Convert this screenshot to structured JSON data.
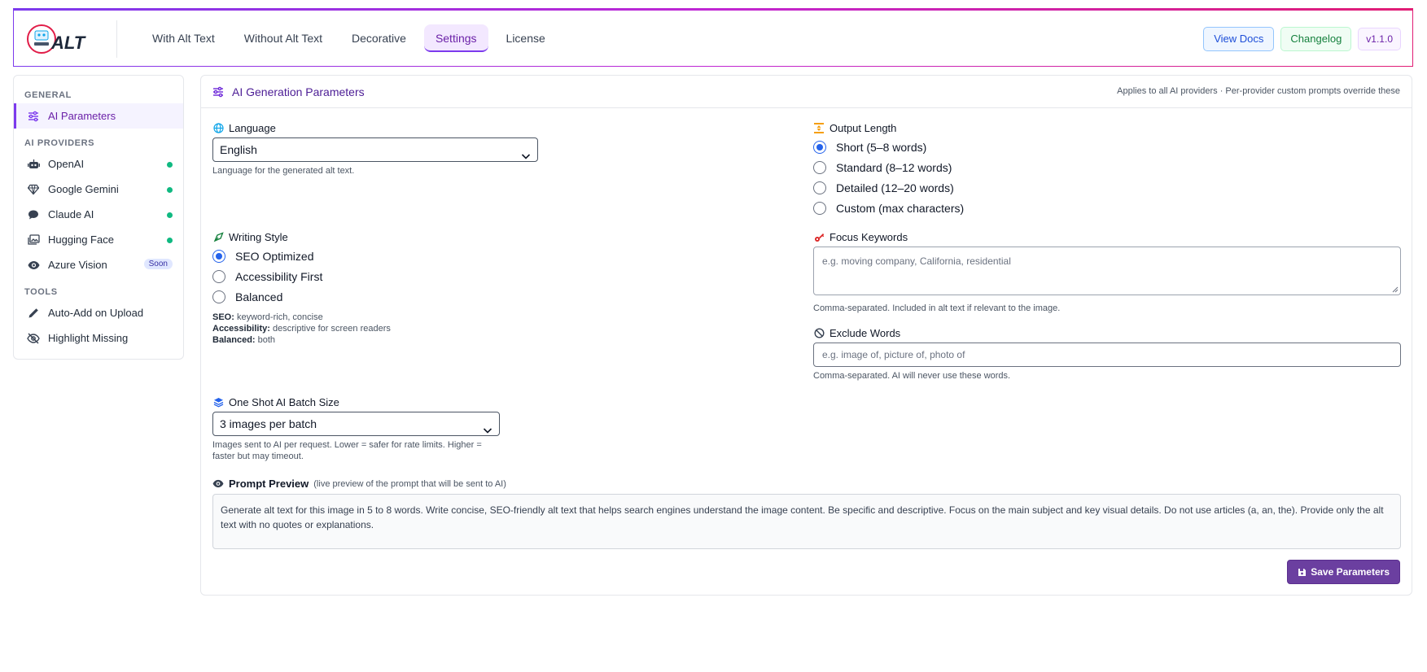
{
  "header": {
    "logo_text": "ALT",
    "tabs": [
      {
        "label": "With Alt Text"
      },
      {
        "label": "Without Alt Text"
      },
      {
        "label": "Decorative"
      },
      {
        "label": "Settings"
      },
      {
        "label": "License"
      }
    ],
    "active_tab": "Settings",
    "view_docs_label": "View Docs",
    "changelog_label": "Changelog",
    "version": "v1.1.0",
    "accent_colors": [
      "#7c3aed",
      "#c026d3",
      "#e11d74"
    ]
  },
  "sidebar": {
    "general_label": "GENERAL",
    "providers_label": "AI PROVIDERS",
    "tools_label": "TOOLS",
    "items": {
      "ai_parameters": {
        "label": "AI Parameters",
        "icon": "sliders-icon"
      },
      "openai": {
        "label": "OpenAI",
        "icon": "robot-icon",
        "status": "active"
      },
      "gemini": {
        "label": "Google Gemini",
        "icon": "gem-icon",
        "status": "active"
      },
      "claude": {
        "label": "Claude AI",
        "icon": "chat-icon",
        "status": "active"
      },
      "hugging": {
        "label": "Hugging Face",
        "icon": "images-icon",
        "status": "active"
      },
      "azure": {
        "label": "Azure Vision",
        "icon": "eye-icon",
        "badge": "Soon"
      },
      "auto_add": {
        "label": "Auto-Add on Upload",
        "icon": "pencil-icon"
      },
      "highlight": {
        "label": "Highlight Missing",
        "icon": "eye-slash-icon"
      }
    }
  },
  "main": {
    "title": "AI Generation Parameters",
    "note": "Applies to all AI providers · Per-provider custom prompts override these",
    "language": {
      "label": "Language",
      "value": "English",
      "help": "Language for the generated alt text."
    },
    "output_length": {
      "label": "Output Length",
      "options": [
        {
          "label": "Short (5–8 words)",
          "selected": true
        },
        {
          "label": "Standard (8–12 words)",
          "selected": false
        },
        {
          "label": "Detailed (12–20 words)",
          "selected": false
        },
        {
          "label": "Custom (max characters)",
          "selected": false
        }
      ]
    },
    "writing_style": {
      "label": "Writing Style",
      "options": [
        {
          "label": "SEO Optimized",
          "selected": true
        },
        {
          "label": "Accessibility First",
          "selected": false
        },
        {
          "label": "Balanced",
          "selected": false
        }
      ],
      "help": [
        {
          "key": "SEO:",
          "text": "keyword-rich, concise"
        },
        {
          "key": "Accessibility:",
          "text": "descriptive for screen readers"
        },
        {
          "key": "Balanced:",
          "text": "both"
        }
      ]
    },
    "focus_keywords": {
      "label": "Focus Keywords",
      "placeholder": "e.g. moving company, California, residential",
      "help": "Comma-separated. Included in alt text if relevant to the image."
    },
    "exclude_words": {
      "label": "Exclude Words",
      "placeholder": "e.g. image of, picture of, photo of",
      "help": "Comma-separated. AI will never use these words."
    },
    "batch_size": {
      "label": "One Shot AI Batch Size",
      "value": "3 images per batch",
      "help_line1": "Images sent to AI per request. Lower = safer for rate limits. Higher =",
      "help_line2": "faster but may timeout."
    },
    "prompt_preview": {
      "label": "Prompt Preview",
      "sublabel": "(live preview of the prompt that will be sent to AI)",
      "text": "Generate alt text for this image in 5 to 8 words. Write concise, SEO-friendly alt text that helps search engines understand the image content. Be specific and descriptive. Focus on the main subject and key visual details. Do not use articles (a, an, the). Provide only the alt text with no quotes or explanations."
    },
    "save_label": "Save Parameters"
  }
}
